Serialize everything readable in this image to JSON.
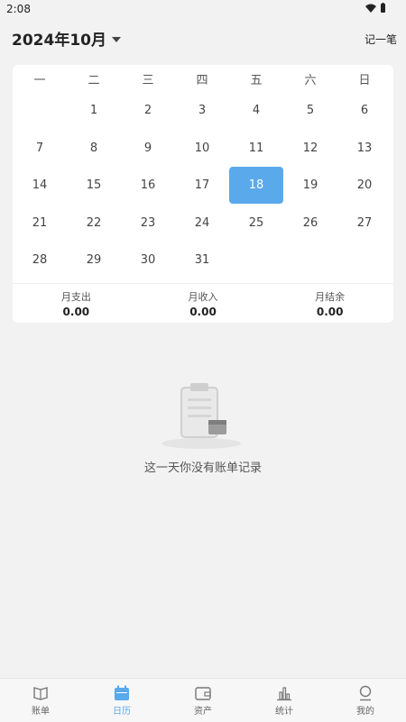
{
  "status": {
    "time": "2:08"
  },
  "header": {
    "month": "2024年10月",
    "add_label": "记一笔"
  },
  "calendar": {
    "weekdays": [
      "一",
      "二",
      "三",
      "四",
      "五",
      "六",
      "日"
    ],
    "weeks": [
      [
        "",
        "1",
        "2",
        "3",
        "4",
        "5",
        "6"
      ],
      [
        "7",
        "8",
        "9",
        "10",
        "11",
        "12",
        "13"
      ],
      [
        "14",
        "15",
        "16",
        "17",
        "18",
        "19",
        "20"
      ],
      [
        "21",
        "22",
        "23",
        "24",
        "25",
        "26",
        "27"
      ],
      [
        "28",
        "29",
        "30",
        "31",
        "",
        "",
        ""
      ]
    ],
    "selected_day": "18"
  },
  "summary": {
    "expense_label": "月支出",
    "expense_value": "0.00",
    "income_label": "月收入",
    "income_value": "0.00",
    "balance_label": "月结余",
    "balance_value": "0.00"
  },
  "empty_state": {
    "text": "这一天你没有账单记录"
  },
  "tabs": [
    {
      "label": "账单",
      "icon": "book-icon",
      "active": false
    },
    {
      "label": "日历",
      "icon": "calendar-icon",
      "active": true
    },
    {
      "label": "资产",
      "icon": "wallet-icon",
      "active": false
    },
    {
      "label": "统计",
      "icon": "chart-icon",
      "active": false
    },
    {
      "label": "我的",
      "icon": "user-icon",
      "active": false
    }
  ],
  "colors": {
    "accent": "#5aa9eb",
    "background": "#f2f2f2"
  }
}
